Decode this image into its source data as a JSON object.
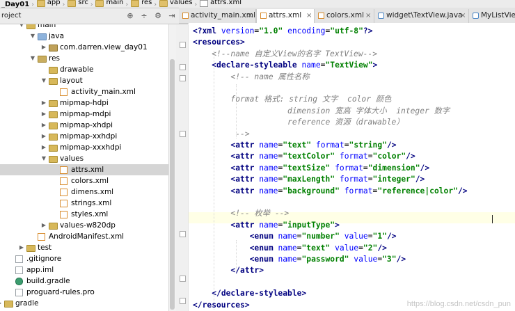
{
  "breadcrumbs": [
    "_Day01",
    "app",
    "src",
    "main",
    "res",
    "values",
    "attrs.xml"
  ],
  "project_view": {
    "selector_label": "roject"
  },
  "tree": {
    "rows": [
      {
        "label": "main",
        "depth": 2,
        "expanded": true,
        "icon": "folder-icon"
      },
      {
        "label": "java",
        "depth": 3,
        "expanded": true,
        "icon": "source-folder-icon"
      },
      {
        "label": "com.darren.view_day01",
        "depth": 4,
        "expanded": false,
        "icon": "package-icon"
      },
      {
        "label": "res",
        "depth": 3,
        "expanded": true,
        "icon": "res-folder-icon"
      },
      {
        "label": "drawable",
        "depth": 4,
        "expanded": null,
        "icon": "folder-icon"
      },
      {
        "label": "layout",
        "depth": 4,
        "expanded": true,
        "icon": "folder-icon"
      },
      {
        "label": "activity_main.xml",
        "depth": 5,
        "expanded": null,
        "icon": "xml-file-icon"
      },
      {
        "label": "mipmap-hdpi",
        "depth": 4,
        "expanded": false,
        "icon": "folder-icon"
      },
      {
        "label": "mipmap-mdpi",
        "depth": 4,
        "expanded": false,
        "icon": "folder-icon"
      },
      {
        "label": "mipmap-xhdpi",
        "depth": 4,
        "expanded": false,
        "icon": "folder-icon"
      },
      {
        "label": "mipmap-xxhdpi",
        "depth": 4,
        "expanded": false,
        "icon": "folder-icon"
      },
      {
        "label": "mipmap-xxxhdpi",
        "depth": 4,
        "expanded": false,
        "icon": "folder-icon"
      },
      {
        "label": "values",
        "depth": 4,
        "expanded": true,
        "icon": "folder-icon"
      },
      {
        "label": "attrs.xml",
        "depth": 5,
        "expanded": null,
        "icon": "xml-file-icon",
        "selected": true
      },
      {
        "label": "colors.xml",
        "depth": 5,
        "expanded": null,
        "icon": "xml-file-icon"
      },
      {
        "label": "dimens.xml",
        "depth": 5,
        "expanded": null,
        "icon": "xml-file-icon"
      },
      {
        "label": "strings.xml",
        "depth": 5,
        "expanded": null,
        "icon": "xml-file-icon"
      },
      {
        "label": "styles.xml",
        "depth": 5,
        "expanded": null,
        "icon": "xml-file-icon"
      },
      {
        "label": "values-w820dp",
        "depth": 4,
        "expanded": false,
        "icon": "folder-icon"
      },
      {
        "label": "AndroidManifest.xml",
        "depth": 3,
        "expanded": null,
        "icon": "xml-file-icon"
      },
      {
        "label": "test",
        "depth": 2,
        "expanded": false,
        "icon": "folder-icon"
      },
      {
        "label": ".gitignore",
        "depth": 1,
        "expanded": null,
        "icon": "text-file-icon"
      },
      {
        "label": "app.iml",
        "depth": 1,
        "expanded": null,
        "icon": "text-file-icon"
      },
      {
        "label": "build.gradle",
        "depth": 1,
        "expanded": null,
        "icon": "gradle-file-icon"
      },
      {
        "label": "proguard-rules.pro",
        "depth": 1,
        "expanded": null,
        "icon": "text-file-icon"
      },
      {
        "label": "gradle",
        "depth": 0,
        "expanded": false,
        "icon": "folder-icon"
      }
    ]
  },
  "tabs": [
    {
      "label": "activity_main.xml",
      "icon": "xml-file-icon",
      "active": false
    },
    {
      "label": "attrs.xml",
      "icon": "xml-file-icon",
      "active": true
    },
    {
      "label": "colors.xml",
      "icon": "xml-file-icon",
      "active": false
    },
    {
      "label": "widget\\TextView.java",
      "icon": "java-class-icon",
      "active": false
    },
    {
      "label": "MyListView.java",
      "icon": "java-class-icon",
      "active": false
    }
  ],
  "editor": {
    "lines": [
      [
        {
          "t": "<?xml ",
          "c": "k"
        },
        {
          "t": "version",
          "c": "an"
        },
        {
          "t": "=",
          "c": ""
        },
        {
          "t": "\"1.0\"",
          "c": "av"
        },
        {
          "t": " ",
          "c": ""
        },
        {
          "t": "encoding",
          "c": "an"
        },
        {
          "t": "=",
          "c": ""
        },
        {
          "t": "\"utf-8\"",
          "c": "av"
        },
        {
          "t": "?>",
          "c": "k"
        }
      ],
      [
        {
          "t": "<resources>",
          "c": "k"
        }
      ],
      [
        {
          "t": "    ",
          "c": ""
        },
        {
          "t": "<!--name 自定义View的名字 TextView-->",
          "c": "cm"
        }
      ],
      [
        {
          "t": "    ",
          "c": ""
        },
        {
          "t": "<declare-styleable ",
          "c": "k"
        },
        {
          "t": "name",
          "c": "an"
        },
        {
          "t": "=",
          "c": ""
        },
        {
          "t": "\"TextView\"",
          "c": "av"
        },
        {
          "t": ">",
          "c": "k"
        }
      ],
      [
        {
          "t": "        ",
          "c": ""
        },
        {
          "t": "<!-- name 属性名称",
          "c": "cm"
        }
      ],
      [],
      [
        {
          "t": "        ",
          "c": ""
        },
        {
          "t": "format 格式: string 文字  color 颜色",
          "c": "cm"
        }
      ],
      [
        {
          "t": "                    ",
          "c": ""
        },
        {
          "t": "dimension 宽高 字体大小  integer 数字",
          "c": "cm"
        }
      ],
      [
        {
          "t": "                    ",
          "c": ""
        },
        {
          "t": "reference 资源（drawable）",
          "c": "cm"
        }
      ],
      [
        {
          "t": "         ",
          "c": ""
        },
        {
          "t": "-->",
          "c": "cm"
        }
      ],
      [
        {
          "t": "        ",
          "c": ""
        },
        {
          "t": "<attr ",
          "c": "k"
        },
        {
          "t": "name",
          "c": "an"
        },
        {
          "t": "=",
          "c": ""
        },
        {
          "t": "\"text\"",
          "c": "av"
        },
        {
          "t": " ",
          "c": ""
        },
        {
          "t": "format",
          "c": "an"
        },
        {
          "t": "=",
          "c": ""
        },
        {
          "t": "\"string\"",
          "c": "av"
        },
        {
          "t": "/>",
          "c": "k"
        }
      ],
      [
        {
          "t": "        ",
          "c": ""
        },
        {
          "t": "<attr ",
          "c": "k"
        },
        {
          "t": "name",
          "c": "an"
        },
        {
          "t": "=",
          "c": ""
        },
        {
          "t": "\"textColor\"",
          "c": "av"
        },
        {
          "t": " ",
          "c": ""
        },
        {
          "t": "format",
          "c": "an"
        },
        {
          "t": "=",
          "c": ""
        },
        {
          "t": "\"color\"",
          "c": "av"
        },
        {
          "t": "/>",
          "c": "k"
        }
      ],
      [
        {
          "t": "        ",
          "c": ""
        },
        {
          "t": "<attr ",
          "c": "k"
        },
        {
          "t": "name",
          "c": "an"
        },
        {
          "t": "=",
          "c": ""
        },
        {
          "t": "\"textSize\"",
          "c": "av"
        },
        {
          "t": " ",
          "c": ""
        },
        {
          "t": "format",
          "c": "an"
        },
        {
          "t": "=",
          "c": ""
        },
        {
          "t": "\"dimension\"",
          "c": "av"
        },
        {
          "t": "/>",
          "c": "k"
        }
      ],
      [
        {
          "t": "        ",
          "c": ""
        },
        {
          "t": "<attr ",
          "c": "k"
        },
        {
          "t": "name",
          "c": "an"
        },
        {
          "t": "=",
          "c": ""
        },
        {
          "t": "\"maxLength\"",
          "c": "av"
        },
        {
          "t": " ",
          "c": ""
        },
        {
          "t": "format",
          "c": "an"
        },
        {
          "t": "=",
          "c": ""
        },
        {
          "t": "\"integer\"",
          "c": "av"
        },
        {
          "t": "/>",
          "c": "k"
        }
      ],
      [
        {
          "t": "        ",
          "c": ""
        },
        {
          "t": "<attr ",
          "c": "k"
        },
        {
          "t": "name",
          "c": "an"
        },
        {
          "t": "=",
          "c": ""
        },
        {
          "t": "\"background\"",
          "c": "av"
        },
        {
          "t": " ",
          "c": ""
        },
        {
          "t": "format",
          "c": "an"
        },
        {
          "t": "=",
          "c": ""
        },
        {
          "t": "\"reference|color\"",
          "c": "av"
        },
        {
          "t": "/>",
          "c": "k"
        }
      ],
      [],
      [
        {
          "t": "        ",
          "c": ""
        },
        {
          "t": "<!-- 枚举 -->",
          "c": "cm"
        }
      ],
      [
        {
          "t": "        ",
          "c": ""
        },
        {
          "t": "<attr ",
          "c": "k"
        },
        {
          "t": "name",
          "c": "an"
        },
        {
          "t": "=",
          "c": ""
        },
        {
          "t": "\"inputType\"",
          "c": "av"
        },
        {
          "t": ">",
          "c": "k"
        }
      ],
      [
        {
          "t": "            ",
          "c": ""
        },
        {
          "t": "<enum ",
          "c": "k"
        },
        {
          "t": "name",
          "c": "an"
        },
        {
          "t": "=",
          "c": ""
        },
        {
          "t": "\"number\"",
          "c": "av"
        },
        {
          "t": " ",
          "c": ""
        },
        {
          "t": "value",
          "c": "an"
        },
        {
          "t": "=",
          "c": ""
        },
        {
          "t": "\"1\"",
          "c": "av"
        },
        {
          "t": "/>",
          "c": "k"
        }
      ],
      [
        {
          "t": "            ",
          "c": ""
        },
        {
          "t": "<enum ",
          "c": "k"
        },
        {
          "t": "name",
          "c": "an"
        },
        {
          "t": "=",
          "c": ""
        },
        {
          "t": "\"text\"",
          "c": "av"
        },
        {
          "t": " ",
          "c": ""
        },
        {
          "t": "value",
          "c": "an"
        },
        {
          "t": "=",
          "c": ""
        },
        {
          "t": "\"2\"",
          "c": "av"
        },
        {
          "t": "/>",
          "c": "k"
        }
      ],
      [
        {
          "t": "            ",
          "c": ""
        },
        {
          "t": "<enum ",
          "c": "k"
        },
        {
          "t": "name",
          "c": "an"
        },
        {
          "t": "=",
          "c": ""
        },
        {
          "t": "\"password\"",
          "c": "av"
        },
        {
          "t": " ",
          "c": ""
        },
        {
          "t": "value",
          "c": "an"
        },
        {
          "t": "=",
          "c": ""
        },
        {
          "t": "\"3\"",
          "c": "av"
        },
        {
          "t": "/>",
          "c": "k"
        }
      ],
      [
        {
          "t": "        ",
          "c": ""
        },
        {
          "t": "</attr>",
          "c": "k"
        }
      ],
      [],
      [
        {
          "t": "    ",
          "c": ""
        },
        {
          "t": "</declare-styleable>",
          "c": "k"
        }
      ],
      [
        {
          "t": "</resources>",
          "c": "k"
        }
      ]
    ]
  },
  "watermark": "https://blog.csdn.net/csdn_pun",
  "colors": {
    "tag": "#000080",
    "attr_name": "#0000ff",
    "attr_value": "#008000",
    "comment": "#808080",
    "selection": "#d5d5d5"
  }
}
